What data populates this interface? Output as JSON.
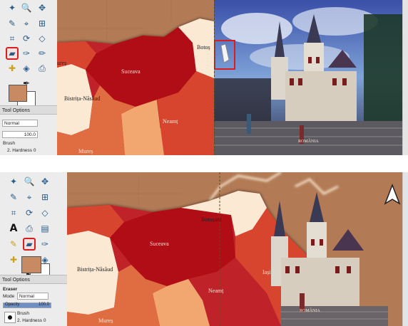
{
  "panels": {
    "top": {
      "tool_options_title": "Tool Options",
      "mode_label": "Normal",
      "opacity_value": "100.0",
      "brush_label": "Brush",
      "hardness_value": "2. Hardness 0",
      "labels": {
        "suceava": "Suceava",
        "botosani": "Botoș",
        "bistrita": "Bistrița-Năsăud",
        "neamt": "Neamț",
        "mures": "Mureș",
        "mures_left": "ureș",
        "romania": "ROMÂNIA"
      }
    },
    "bottom": {
      "tool_options_title": "Tool Options",
      "tool_name": "Eraser",
      "mode_label": "Mode",
      "mode_value": "Normal",
      "opacity_label": "Opacity",
      "opacity_value": "100.0",
      "brush_label": "Brush",
      "hardness_value": "2. Hardness 0",
      "labels": {
        "suceava": "Suceava",
        "botosani": "Botoșani",
        "bistrita": "Bistrița-Năsăud",
        "neamt": "Neamț",
        "mures": "Mureș",
        "iasi": "Iași",
        "romania": "ROMÂNIA",
        "compass": "N"
      }
    }
  },
  "opacity_fraction": 1.0,
  "colors": {
    "suceava": "#b10f12",
    "dark_red": "#c0242a",
    "red_orange": "#d8452e",
    "orange": "#e06c42",
    "light_orange": "#f2a66f",
    "cream": "#fbe9d4",
    "brown_bg": "#b27b56",
    "selection": "#d81e1e"
  },
  "icons": [
    "rect-select-icon",
    "zoom-icon",
    "move-icon",
    "free-select-icon",
    "fuzzy-select-icon",
    "align-icon",
    "crop-icon",
    "rotate-icon",
    "perspective-icon",
    "text-icon",
    "clone-icon",
    "gradient-icon",
    "eraser-icon",
    "color-picker-icon",
    "pencil-icon",
    "heal-icon",
    "smudge-icon",
    "bucket-fill-icon",
    "ink-icon",
    "paintbrush-icon"
  ]
}
